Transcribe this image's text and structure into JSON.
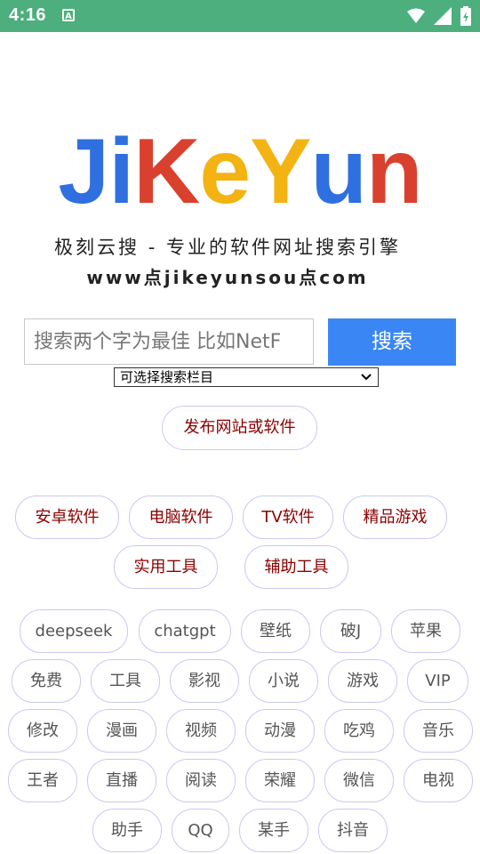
{
  "status_bar": {
    "time": "4:16",
    "notification_glyph": "A",
    "icons": [
      "wifi-icon",
      "signal-icon",
      "battery-icon"
    ]
  },
  "logo": {
    "letters": [
      {
        "char": "J",
        "color": "#2f6fe0"
      },
      {
        "char": "i",
        "color": "#2f6fe0"
      },
      {
        "char": "K",
        "color": "#d9412e"
      },
      {
        "char": "e",
        "color": "#f3b313"
      },
      {
        "char": "Y",
        "color": "#f3b313"
      },
      {
        "char": "u",
        "color": "#2f6fe0"
      },
      {
        "char": "n",
        "color": "#d9412e"
      }
    ]
  },
  "tagline": "极刻云搜 - 专业的软件网址搜索引擎",
  "domain_text": "www点jikeyunsou点com",
  "search": {
    "placeholder": "搜索两个字为最佳 比如NetF",
    "button_label": "搜索"
  },
  "category_select": {
    "selected": "可选择搜索栏目"
  },
  "publish_button": "发布网站或软件",
  "categories": [
    "安卓软件",
    "电脑软件",
    "TV软件",
    "精品游戏",
    "实用工具",
    "辅助工具"
  ],
  "tags": [
    "deepseek",
    "chatgpt",
    "壁纸",
    "破J",
    "苹果",
    "免费",
    "工具",
    "影视",
    "小说",
    "游戏",
    "VIP",
    "修改",
    "漫画",
    "视频",
    "动漫",
    "吃鸡",
    "音乐",
    "王者",
    "直播",
    "阅读",
    "荣耀",
    "微信",
    "电视",
    "助手",
    "QQ",
    "某手",
    "抖音"
  ],
  "colors": {
    "status_bar": "#4caf7d",
    "search_button": "#3a86f4",
    "category_text": "#8b0000",
    "pill_border": "#c9c9f0"
  }
}
